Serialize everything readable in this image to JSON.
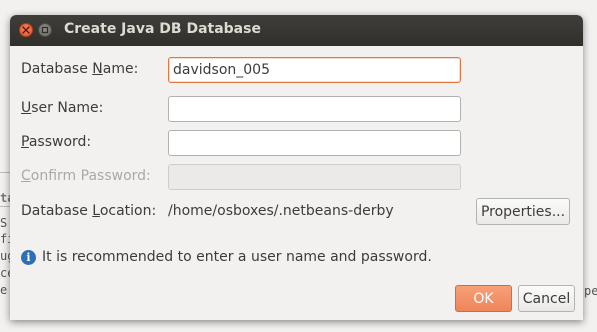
{
  "dialog": {
    "title": "Create Java DB Database",
    "database_name": {
      "label_prefix": "Database ",
      "label_mnemonic": "N",
      "label_suffix": "ame:",
      "value": "davidson_005"
    },
    "user_name": {
      "label_mnemonic": "U",
      "label_suffix": "ser Name:",
      "value": ""
    },
    "password": {
      "label_mnemonic": "P",
      "label_suffix": "assword:",
      "value": ""
    },
    "confirm_password": {
      "label_mnemonic": "C",
      "label_suffix": "onfirm Password:",
      "value": ""
    },
    "database_location": {
      "label_prefix": "Database ",
      "label_mnemonic": "L",
      "label_suffix": "ocation:",
      "value": "/home/osboxes/.netbeans-derby"
    },
    "properties_button": "Properties...",
    "info_message": "It is recommended to enter a user name and password.",
    "ok_button": "OK",
    "cancel_button": "Cancel"
  },
  "background": {
    "fragments": [
      "ta",
      "S",
      "fi",
      "ug",
      "ce",
      "e",
      "pe"
    ]
  },
  "colors": {
    "titlebar": "#3a3935",
    "accent": "#e0773f",
    "ok_button": "#f29068",
    "info_icon": "#2c6fb4"
  },
  "icons": {
    "close": "close-icon",
    "minimize": "minimize-icon",
    "info": "info-icon"
  }
}
